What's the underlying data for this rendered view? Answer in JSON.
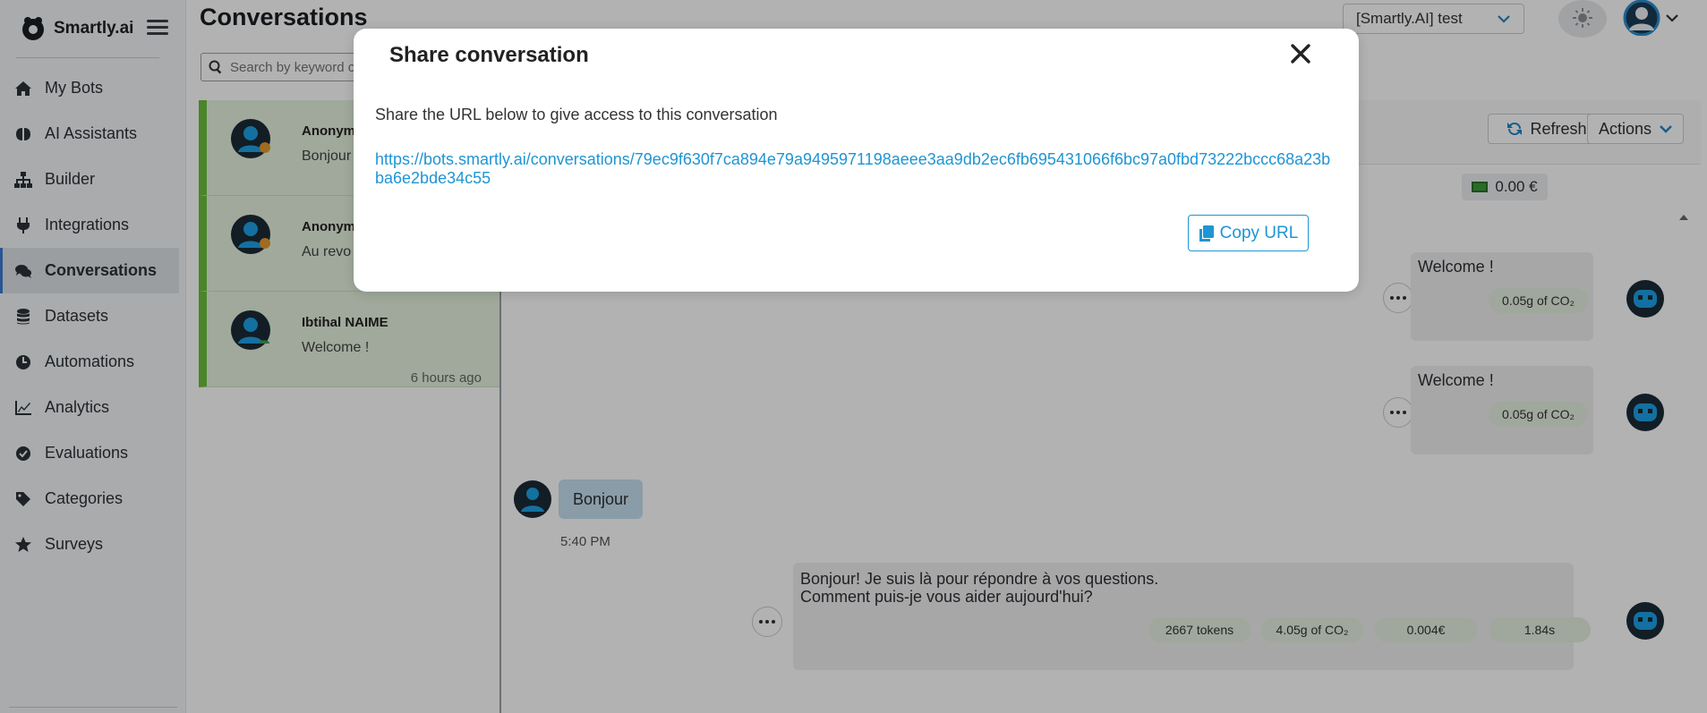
{
  "app": {
    "name": "Smartly.ai"
  },
  "sidebar": {
    "items": [
      {
        "label": "My Bots",
        "icon": "home-icon"
      },
      {
        "label": "AI Assistants",
        "icon": "brain-icon"
      },
      {
        "label": "Builder",
        "icon": "sitemap-icon"
      },
      {
        "label": "Integrations",
        "icon": "plug-icon"
      },
      {
        "label": "Conversations",
        "icon": "comments-icon",
        "active": true
      },
      {
        "label": "Datasets",
        "icon": "database-icon"
      },
      {
        "label": "Automations",
        "icon": "clock-icon"
      },
      {
        "label": "Analytics",
        "icon": "line-chart-icon"
      },
      {
        "label": "Evaluations",
        "icon": "check-circle-icon"
      },
      {
        "label": "Categories",
        "icon": "tag-icon"
      },
      {
        "label": "Surveys",
        "icon": "star-icon"
      }
    ]
  },
  "header": {
    "title": "Conversations",
    "project": "[Smartly.AI] test"
  },
  "search": {
    "placeholder": "Search by keyword o"
  },
  "conversations": [
    {
      "name": "Anonym",
      "preview": "Bonjour",
      "time": ""
    },
    {
      "name": "Anonym",
      "preview": "Au revo",
      "time": ""
    },
    {
      "name": "Ibtihal NAIME",
      "preview": "Welcome !",
      "time": "6 hours ago"
    }
  ],
  "toolbar": {
    "refresh_label": "Refresh",
    "actions_label": "Actions",
    "cost": "0.00 €"
  },
  "messages": {
    "bot1": {
      "text": "Welcome !",
      "co2": "0.05g of CO₂"
    },
    "bot2": {
      "text": "Welcome !",
      "co2": "0.05g of CO₂"
    },
    "user1": {
      "text": "Bonjour",
      "time": "5:40 PM"
    },
    "bot3": {
      "line1": "Bonjour! Je suis là pour répondre à vos questions.",
      "line2": "Comment puis-je vous aider aujourd'hui?",
      "tokens": "2667 tokens",
      "co2": "4.05g of CO₂",
      "cost": "0.004€",
      "duration": "1.84s"
    }
  },
  "modal": {
    "title": "Share conversation",
    "description": "Share the URL below to give access to this conversation",
    "url": "https://bots.smartly.ai/conversations/79ec9f630f7ca894e79a9495971198aeee3aa9db2ec6fb695431066f6bc97a0fbd73222bccc68a23bba6e2bde34c55",
    "copy_label": "Copy URL"
  },
  "colors": {
    "accent": "#1f95d3",
    "active_green": "#6bbf3c",
    "bot_avatar": "#1ea1e6"
  }
}
